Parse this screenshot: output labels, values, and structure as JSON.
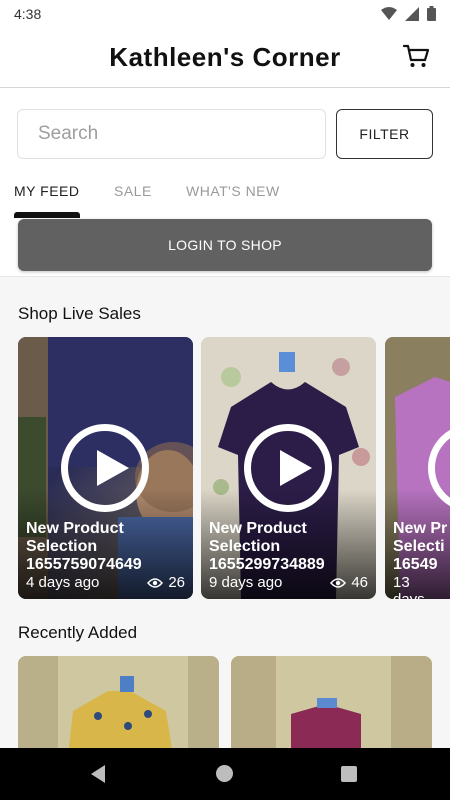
{
  "status_bar": {
    "time": "4:38"
  },
  "header": {
    "title": "Kathleen's Corner",
    "cart_icon": "cart-icon"
  },
  "search": {
    "placeholder": "Search",
    "value": ""
  },
  "filter": {
    "label": "FILTER"
  },
  "tabs": [
    {
      "label": "MY FEED",
      "active": true
    },
    {
      "label": "SALE",
      "active": false
    },
    {
      "label": "WHAT'S NEW",
      "active": false
    }
  ],
  "login": {
    "label": "LOGIN TO SHOP"
  },
  "live_sales": {
    "title": "Shop Live Sales",
    "cards": [
      {
        "title_line1": "New Product",
        "title_line2": "Selection",
        "title_line3": "1655759074649",
        "time": "4 days ago",
        "views": "26"
      },
      {
        "title_line1": "New Product",
        "title_line2": "Selection",
        "title_line3": "1655299734889",
        "time": "9 days ago",
        "views": "46"
      },
      {
        "title_line1": "New Pr",
        "title_line2": "Selecti",
        "title_line3": "16549",
        "time": "13 days",
        "views": ""
      }
    ]
  },
  "recently_added": {
    "title": "Recently Added"
  },
  "colors": {
    "login_button": "#616161",
    "active_tab": "#111111",
    "inactive_tab": "#9a9a9a"
  }
}
